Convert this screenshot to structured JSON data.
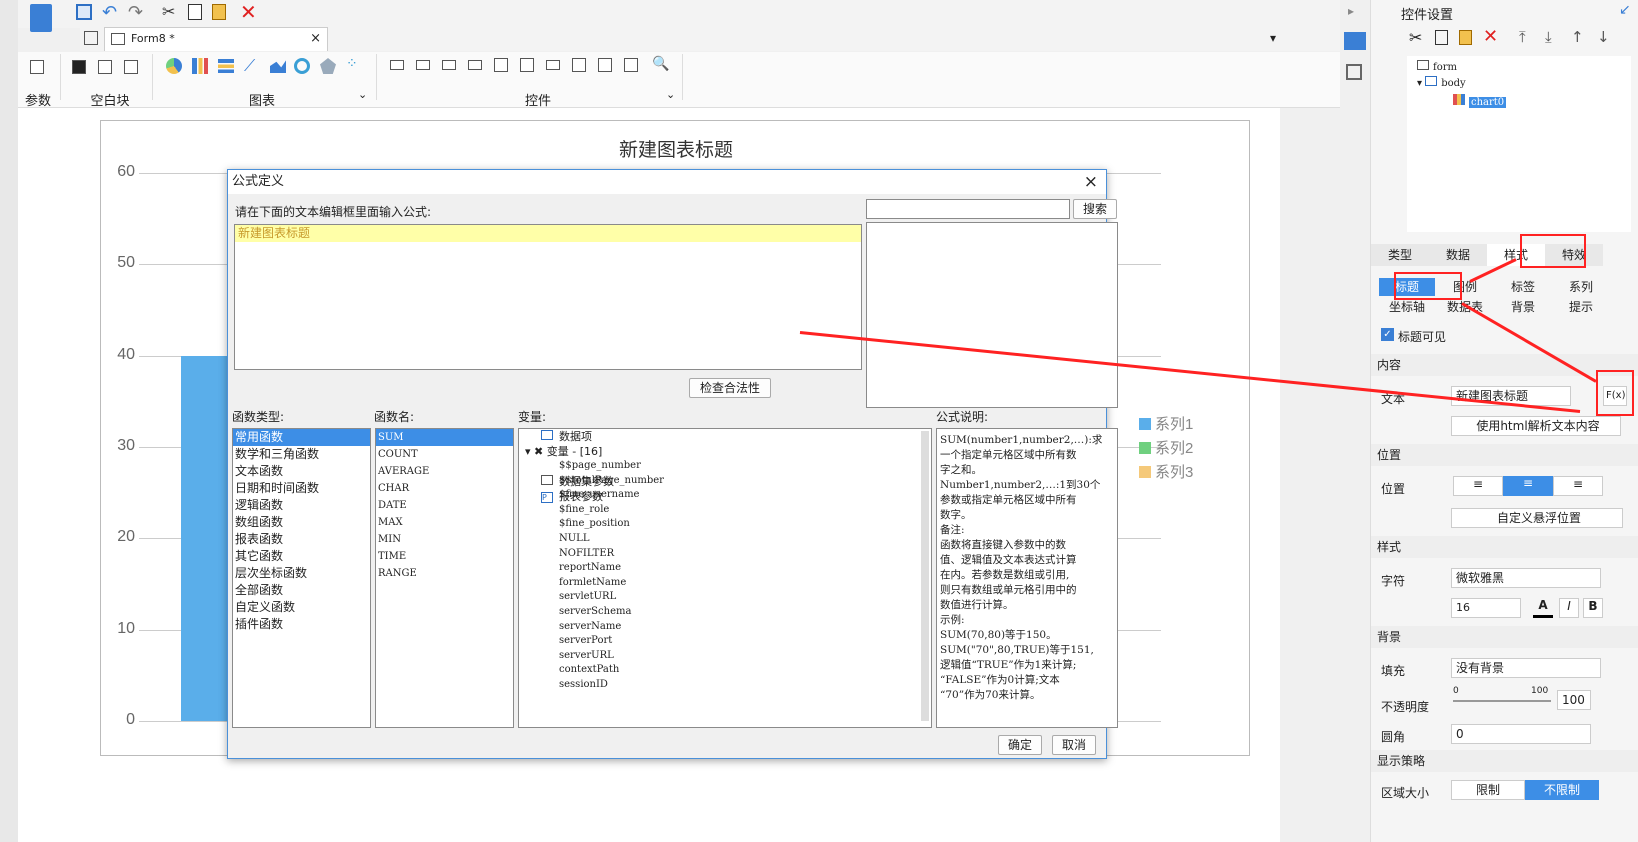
{
  "tab": {
    "title": "Form8 *"
  },
  "ribbon": {
    "groups": [
      "参数",
      "空白块",
      "图表",
      "控件"
    ]
  },
  "chart": {
    "title": "新建图表标题"
  },
  "chart_data": {
    "type": "bar",
    "title": "新建图表标题",
    "yticks": [
      "0",
      "10",
      "20",
      "30",
      "40",
      "50",
      "60"
    ],
    "ylim": [
      0,
      60
    ],
    "series": [
      {
        "name": "系列1",
        "color": "#5aaeea",
        "values": [
          40
        ]
      },
      {
        "name": "系列2",
        "color": "#6fd07f",
        "values": []
      },
      {
        "name": "系列3",
        "color": "#f5c97a",
        "values": []
      }
    ]
  },
  "dialog": {
    "title": "公式定义",
    "close": "×",
    "prompt": "请在下面的文本编辑框里面输入公式:",
    "formula": "新建图表标题",
    "search_btn": "搜索",
    "search_value": "",
    "check_btn": "检查合法性",
    "func_type_label": "函数类型:",
    "func_name_label": "函数名:",
    "var_label": "变量:",
    "desc_label": "公式说明:",
    "func_types": [
      "常用函数",
      "数学和三角函数",
      "文本函数",
      "日期和时间函数",
      "逻辑函数",
      "数组函数",
      "报表函数",
      "其它函数",
      "层次坐标函数",
      "全部函数",
      "自定义函数",
      "插件函数"
    ],
    "func_names": [
      "SUM",
      "COUNT",
      "AVERAGE",
      "CHAR",
      "DATE",
      "MAX",
      "MIN",
      "TIME",
      "RANGE"
    ],
    "vars": {
      "data_item": "数据项",
      "var_group": "变量 - [16]",
      "items": [
        "$$page_number",
        "$$totalPage_number",
        "$fine_username",
        "$fine_role",
        "$fine_position",
        "NULL",
        "NOFILTER",
        "reportName",
        "formletName",
        "servletURL",
        "serverSchema",
        "serverName",
        "serverPort",
        "serverURL",
        "contextPath",
        "sessionID"
      ],
      "dataset_params": "数据集参数",
      "report_params": "报表参数"
    },
    "desc": [
      "SUM(number1,number2,…):求",
      "一个指定单元格区域中所有数",
      "字之和。",
      "Number1,number2,…:1到30个",
      "参数或指定单元格区域中所有",
      "数字。",
      "备注:",
      "函数将直接键入参数中的数",
      "值、逻辑值及文本表达式计算",
      "在内。若参数是数组或引用,",
      "则只有数组或单元格引用中的",
      "数值进行计算。",
      "示例:",
      "SUM(70,80)等于150。",
      "SUM(\"70\",80,TRUE)等于151,",
      "逻辑值“TRUE”作为1来计算;",
      "“FALSE”作为0计算;文本",
      "“70”作为70来计算。"
    ],
    "ok": "确定",
    "cancel": "取消"
  },
  "panel": {
    "title": "控件设置",
    "tree": [
      "form",
      "body",
      "chart0"
    ],
    "tabs": [
      "类型",
      "数据",
      "样式",
      "特效"
    ],
    "subtabs": [
      "标题",
      "图例",
      "标签",
      "系列",
      "坐标轴",
      "数据表",
      "背景",
      "提示"
    ],
    "title_visible": "标题可见",
    "sec_content": "内容",
    "text_label": "文本",
    "text_value": "新建图表标题",
    "fx": "F(x)",
    "html_btn": "使用html解析文本内容",
    "sec_pos": "位置",
    "pos_label": "位置",
    "float_btn": "自定义悬浮位置",
    "sec_style": "样式",
    "font_label": "字符",
    "font_value": "微软雅黑",
    "size_value": "16",
    "bold": "B",
    "italic": "I",
    "color_a": "A",
    "sec_bg": "背景",
    "fill_label": "填充",
    "fill_value": "没有背景",
    "opacity_label": "不透明度",
    "op_min": "0",
    "op_max": "100",
    "op_value": "100",
    "radius_label": "圆角",
    "radius_value": "0",
    "sec_display": "显示策略",
    "area_label": "区域大小",
    "limit": "限制",
    "nolimit": "不限制"
  }
}
